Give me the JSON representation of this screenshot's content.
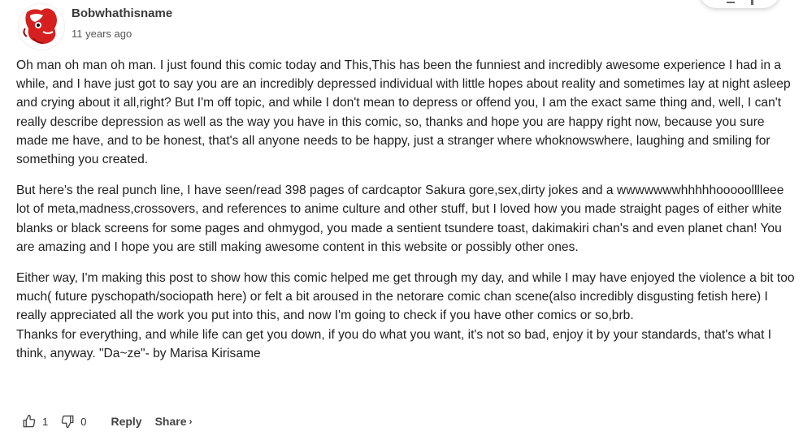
{
  "comment": {
    "author": "Bobwhathisname",
    "timestamp": "11 years ago",
    "paragraphs": [
      "Oh man oh man oh man. I just found this comic today and This,This has been the funniest and incredibly awesome experience I had in a while, and I have just got to say you are an incredibly depressed individual with little hopes about reality and sometimes lay at night asleep and crying about it all,right? But I'm off topic, and while I don't mean to depress or offend you, I am the exact same thing and, well, I can't really describe depression as well as the way you have in this comic, so, thanks and hope you are happy right now, because you sure made me have, and to be honest, that's all anyone needs to be happy, just a stranger where whoknowswhere, laughing and smiling for something you created.",
      "But here's the real punch line, I have seen/read 398 pages of cardcaptor Sakura gore,sex,dirty jokes and a wwwwwwwhhhhhooooolllleee lot of meta,madness,crossovers, and references to anime culture and other stuff, but I loved how you made straight pages of either white blanks or black screens for some pages and ohmygod, you made a sentient tsundere toast, dakimakiri chan's and even planet chan! You are amazing and I hope you are still making awesome content in this website or possibly other ones.",
      "Either way, I'm making this post to show how this comic helped me get through my day, and while I may have enjoyed the violence a bit too much( future pyschopath/sociopath here) or felt a bit aroused in the netorare comic chan scene(also incredibly disgusting fetish here) I really appreciated all the work you put into this, and now I'm going to check if you have other comics or so,brb.",
      "Thanks for everything, and while life can get you down, if you do what you want, it's not so bad, enjoy it by your standards, that's what I think, anyway. \"Da~ze\"- by Marisa Kirisame"
    ],
    "likes": "1",
    "dislikes": "0",
    "reply_label": "Reply",
    "share_label": "Share",
    "share_chevron": "›"
  },
  "icons": {
    "like": "thumbs-up-icon",
    "dislike": "thumbs-down-icon",
    "share": "chevron-right-icon"
  },
  "colors": {
    "avatar_red": "#d62020",
    "text": "#1f1f1f",
    "muted": "#555555"
  }
}
